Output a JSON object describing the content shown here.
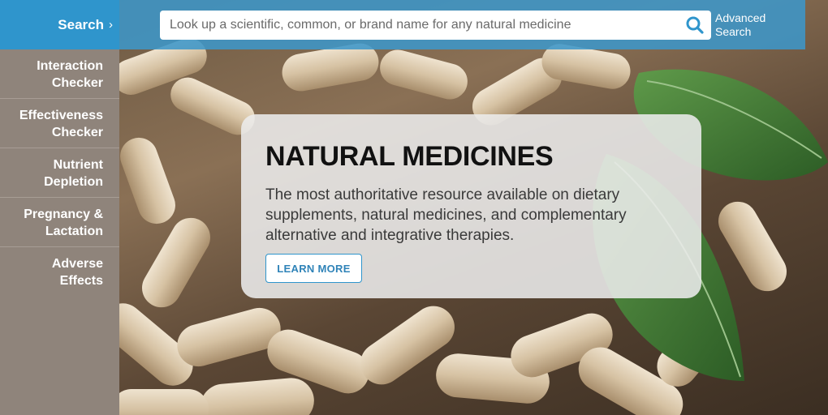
{
  "sidebar": {
    "search_label": "Search",
    "items": [
      {
        "label": "Interaction\nChecker"
      },
      {
        "label": "Effectiveness\nChecker"
      },
      {
        "label": "Nutrient\nDepletion"
      },
      {
        "label": "Pregnancy &\nLactation"
      },
      {
        "label": "Adverse\nEffects"
      }
    ]
  },
  "search": {
    "placeholder": "Look up a scientific, common, or brand name for any natural medicine",
    "advanced_label": "Advanced Search"
  },
  "hero": {
    "title": "NATURAL MEDICINES",
    "description": "The most authoritative resource available on dietary supplements, natural medicines, and complementary alternative and integrative therapies.",
    "cta_label": "LEARN MORE"
  },
  "colors": {
    "accent": "#2f95cc",
    "sidebar": "#8f847b"
  }
}
